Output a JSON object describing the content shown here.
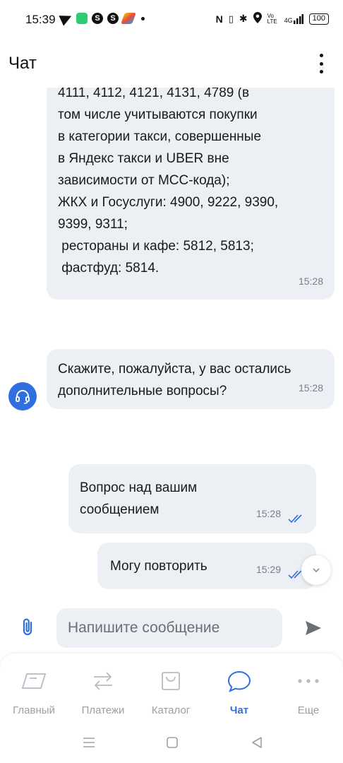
{
  "status_bar": {
    "time": "15:39",
    "network": "4G",
    "volte": "Vo LTE",
    "battery": "100"
  },
  "header": {
    "title": "Чат"
  },
  "messages": {
    "bot_1": {
      "lines": [
        "4111, 4112, 4121, 4131, 4789 (в",
        "том числе учитываются покупки",
        "в категории такси, совершенные",
        "в Яндекс такси и UBER вне",
        "зависимости от МСС-кода);",
        "ЖКХ и Госуслуги: 4900, 9222, 9390,",
        "9399, 9311;",
        " рестораны и кафе: 5812, 5813;",
        " фастфуд: 5814."
      ],
      "time": "15:28"
    },
    "bot_2": {
      "lines": [
        "Скажите, пожалуйста, у вас остались",
        "дополнительные вопросы?"
      ],
      "time": "15:28"
    },
    "user_1": {
      "lines": [
        "Вопрос над вашим",
        "сообщением"
      ],
      "time": "15:28"
    },
    "user_2": {
      "lines": [
        "Могу повторить"
      ],
      "time": "15:29"
    }
  },
  "composer": {
    "placeholder": "Напишите сообщение"
  },
  "bottom_nav": {
    "items": [
      {
        "label": "Главный",
        "icon": "home-card-icon"
      },
      {
        "label": "Платежи",
        "icon": "transfer-arrows-icon"
      },
      {
        "label": "Каталог",
        "icon": "shopping-bag-icon"
      },
      {
        "label": "Чат",
        "icon": "chat-bubble-icon",
        "active": true
      },
      {
        "label": "Еще",
        "icon": "more-dots-icon"
      }
    ]
  },
  "colors": {
    "accent": "#2f6fe0",
    "bubble": "#eceff3",
    "muted": "#9aa0a8"
  }
}
